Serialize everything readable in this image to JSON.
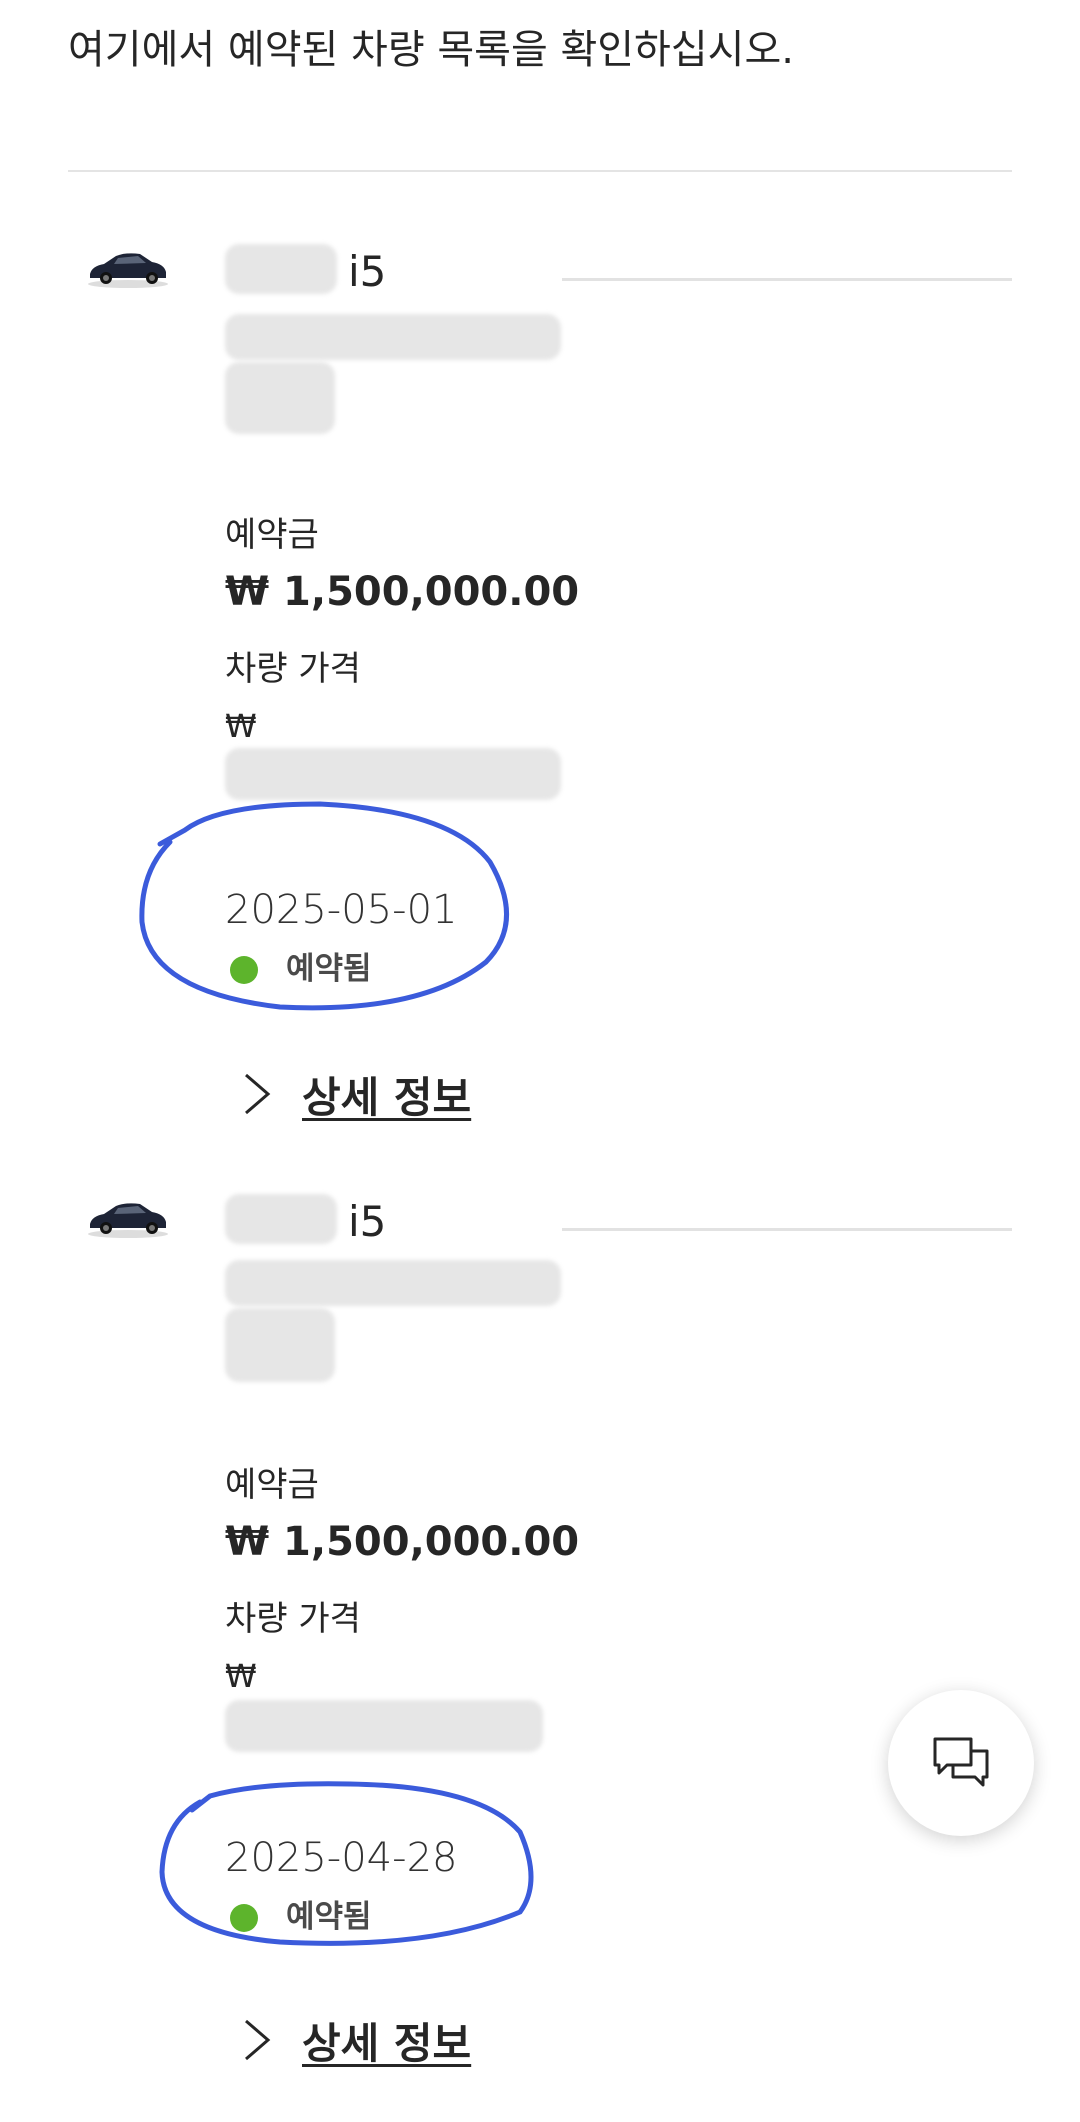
{
  "intro_text": "여기에서 예약된 차량 목록을 확인하십시오.",
  "reservations": [
    {
      "model": "i5",
      "deposit_label": "예약금",
      "deposit_amount": "₩ 1,500,000.00",
      "price_label": "차량 가격",
      "price_currency": "₩",
      "date": "2025-05-01",
      "status": "예약됨",
      "status_color": "#5db42c",
      "detail_link": "상세 정보"
    },
    {
      "model": "i5",
      "deposit_label": "예약금",
      "deposit_amount": "₩ 1,500,000.00",
      "price_label": "차량 가격",
      "price_currency": "₩",
      "date": "2025-04-28",
      "status": "예약됨",
      "status_color": "#5db42c",
      "detail_link": "상세 정보"
    }
  ],
  "icons": {
    "car_thumbnail": "car-image",
    "chevron": "chevron-right-icon",
    "chat": "chat-bubbles-icon"
  },
  "annotation_color": "#3b5bdb"
}
